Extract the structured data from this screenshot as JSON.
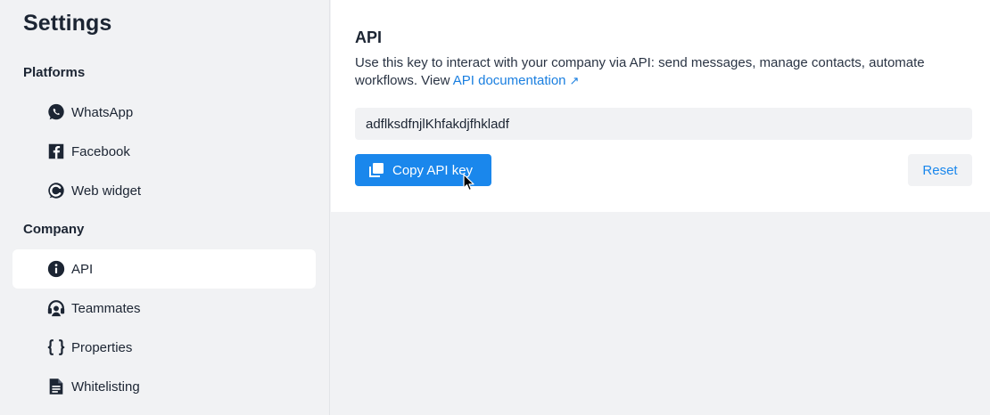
{
  "sidebar": {
    "title": "Settings",
    "sections": [
      {
        "heading": "Platforms",
        "items": [
          {
            "label": "WhatsApp",
            "icon": "whatsapp-icon"
          },
          {
            "label": "Facebook",
            "icon": "facebook-icon"
          },
          {
            "label": "Web widget",
            "icon": "web-widget-icon"
          }
        ]
      },
      {
        "heading": "Company",
        "items": [
          {
            "label": "API",
            "icon": "info-icon",
            "active": true
          },
          {
            "label": "Teammates",
            "icon": "headset-icon"
          },
          {
            "label": "Properties",
            "icon": "braces-icon"
          },
          {
            "label": "Whitelisting",
            "icon": "document-icon"
          }
        ]
      }
    ]
  },
  "api": {
    "title": "API",
    "description": "Use this key to interact with your company via API: send messages, manage contacts, automate workflows. View",
    "doc_link": "API documentation",
    "doc_link_arrow": "↗",
    "key_value": "adflksdfnjlKhfakdjfhkladf",
    "copy_label": "Copy API key",
    "reset_label": "Reset"
  },
  "colors": {
    "accent": "#1a87ec",
    "link": "#1a7fe0",
    "sidebar_bg": "#f1f2f4",
    "text": "#1c2533"
  }
}
